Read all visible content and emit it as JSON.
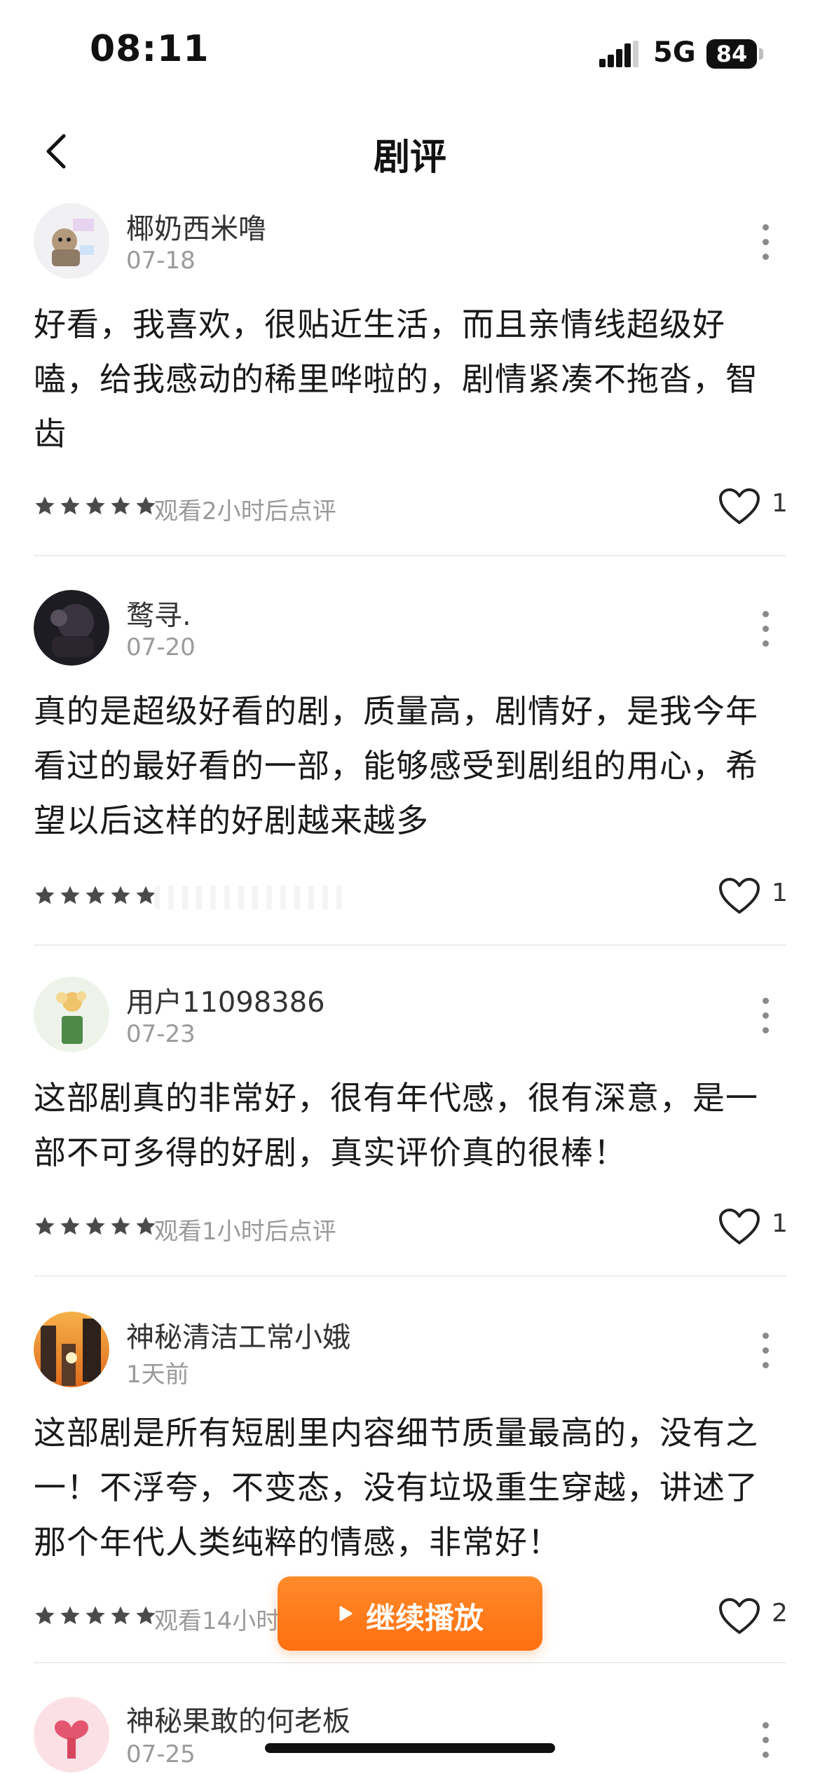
{
  "status_bar": {
    "time": "08:11",
    "network": "5G",
    "battery": "84"
  },
  "nav": {
    "title": "剧评"
  },
  "reviews": [
    {
      "username": "椰奶西米噜",
      "date": "07-18",
      "text": "好看，我喜欢，很贴近生活，而且亲情线超级好嗑，给我感动的稀里哗啦的，剧情紧凑不拖沓，智齿",
      "rating": 5,
      "watch_note": "观看2小时后点评",
      "likes": "1"
    },
    {
      "username": "鹜寻.",
      "date": "07-20",
      "text": "真的是超级好看的剧，质量高，剧情好，是我今年看过的最好看的一部，能够感受到剧组的用心，希望以后这样的好剧越来越多",
      "rating": 5,
      "watch_note": "",
      "likes": "1"
    },
    {
      "username": "用户11098386",
      "date": "07-23",
      "text": "这部剧真的非常好，很有年代感，很有深意，是一部不可多得的好剧，真实评价真的很棒！",
      "rating": 5,
      "watch_note": "观看1小时后点评",
      "likes": "1"
    },
    {
      "username": "神秘清洁工常小娥",
      "date": "1天前",
      "text": "这部剧是所有短剧里内容细节质量最高的，没有之一！不浮夸，不变态，没有垃圾重生穿越，讲述了那个年代人类纯粹的情感，非常好！",
      "rating": 5,
      "watch_note": "观看14小时",
      "likes": "2"
    },
    {
      "username": "神秘果敢的何老板",
      "date": "07-25"
    }
  ],
  "continue_button": {
    "label": "继续播放"
  },
  "icons": {
    "back": "chevron-left-icon",
    "more": "more-vertical-icon",
    "like": "heart-outline-icon",
    "star": "star-filled-icon",
    "play": "play-icon"
  },
  "colors": {
    "accent": "#ff7a1a",
    "star": "#4a4a4a",
    "muted_text": "#9a9a9a"
  }
}
